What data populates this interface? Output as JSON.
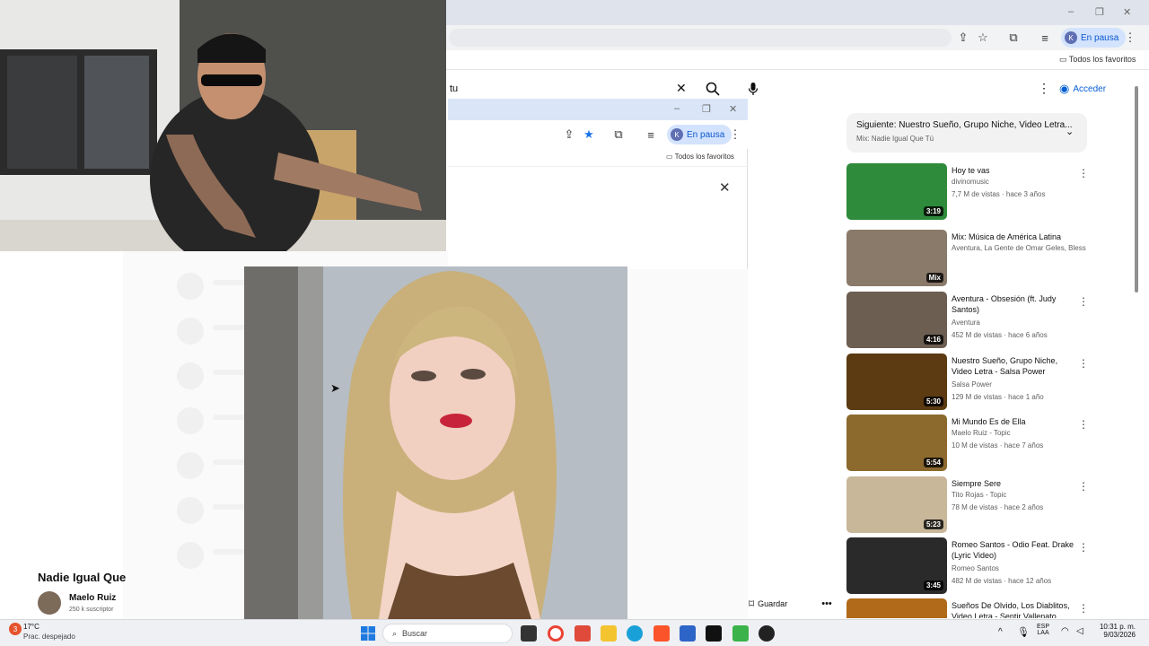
{
  "browser": {
    "profile_initial": "K",
    "profile_status": "En pausa",
    "bookmarks_folder": "Todos los favoritos",
    "window_controls": [
      "–",
      "❐",
      "✕"
    ]
  },
  "youtube": {
    "search_value": "tu",
    "signin_label": "Acceder"
  },
  "popup": {
    "profile_initial": "K",
    "profile_status": "En pausa",
    "bookmarks_folder": "Todos los favoritos",
    "window_controls": [
      "–",
      "❐",
      "✕"
    ]
  },
  "up_next": {
    "title": "Siguiente: Nuestro Sueño, Grupo Niche, Video Letra...",
    "subtitle": "Mix: Nadie Igual Que Tú"
  },
  "recommendations": [
    {
      "title": "Hoy te vas",
      "channel": "divinomusic",
      "meta": "7,7 M de vistas · hace 3 años",
      "duration": "3:19",
      "thumb": "#2e8b3b"
    },
    {
      "title": "Mix: Música de América Latina",
      "channel": "Aventura, La Gente de Omar Geles, Bless...",
      "meta": "",
      "duration": "Mix",
      "thumb": "#8a7a6a"
    },
    {
      "title": "Aventura - Obsesión (ft. Judy Santos)",
      "channel": "Aventura",
      "meta": "452 M de vistas · hace 6 años",
      "duration": "4:16",
      "thumb": "#6d5e52"
    },
    {
      "title": "Nuestro Sueño, Grupo Niche, Video Letra - Salsa Power",
      "channel": "Salsa Power",
      "meta": "129 M de vistas · hace 1 año",
      "duration": "5:30",
      "thumb": "#5c3b12"
    },
    {
      "title": "Mi Mundo Es de Ella",
      "channel": "Maelo Ruiz - Topic",
      "meta": "10 M de vistas · hace 7 años",
      "duration": "5:54",
      "thumb": "#8c6a2e"
    },
    {
      "title": "Siempre Sere",
      "channel": "Tito Rojas - Topic",
      "meta": "78 M de vistas · hace 2 años",
      "duration": "5:23",
      "thumb": "#c9b79a"
    },
    {
      "title": "Romeo Santos - Odio Feat. Drake (Lyric Video)",
      "channel": "Romeo Santos",
      "meta": "482 M de vistas · hace 12 años",
      "duration": "3:45",
      "thumb": "#2a2a2a"
    },
    {
      "title": "Sueños De Olvido, Los Diablitos, Video Letra - Sentir Vallenato",
      "channel": "",
      "meta": "",
      "duration": "",
      "thumb": "#b06a1a"
    }
  ],
  "video": {
    "title": "Nadie Igual Que",
    "channel": "Maelo Ruiz",
    "subscribers": "250 k suscriptor",
    "save_label": "Guardar"
  },
  "taskbar": {
    "weather_temp": "17°C",
    "weather_desc": "Prac. despejado",
    "notification_count": "3",
    "search_placeholder": "Buscar",
    "lang_top": "ESP",
    "lang_bottom": "LAA",
    "time": "10:31 p. m.",
    "date": "9/03/2026"
  }
}
